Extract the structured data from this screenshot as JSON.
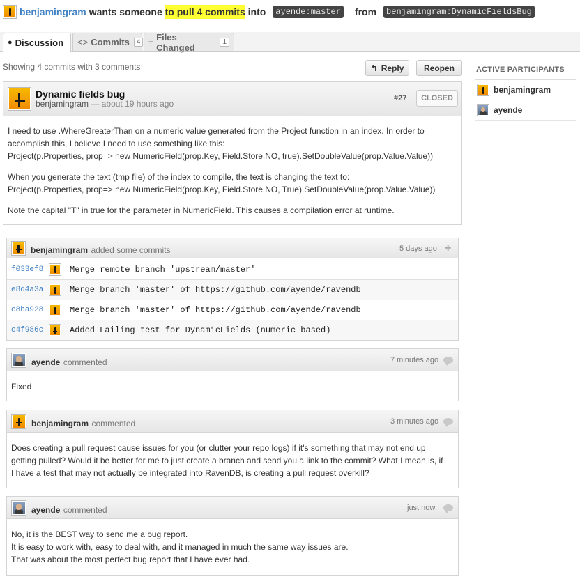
{
  "header": {
    "author": "benjamingram",
    "text_part1": "wants someone ",
    "text_highlight": "to pull 4 commits",
    "text_part2": " into",
    "base_branch": "ayende:master",
    "from": "from",
    "head_branch": "benjamingram:DynamicFieldsBug"
  },
  "tabs": [
    {
      "label": "Discussion",
      "count": ""
    },
    {
      "label": "Commits",
      "count": "4"
    },
    {
      "label": "Files Changed",
      "count": "1"
    }
  ],
  "summary": "Showing 4 commits with 3 comments",
  "buttons": {
    "reply": "Reply",
    "reopen": "Reopen"
  },
  "pull": {
    "title": "Dynamic fields bug",
    "author": "benjamingram",
    "time": "— about 19 hours ago",
    "number": "#27",
    "state": "CLOSED",
    "body": [
      "I need to use .WhereGreaterThan on a numeric value generated from the Project function in an index. In order to",
      "accomplish this, I believe I need to use something like this:",
      "Project(p.Properties, prop=> new NumericField(prop.Key, Field.Store.NO, true).SetDoubleValue(prop.Value.Value))",
      "When you generate the text (tmp file) of the index to compile, the text is changing the text to:",
      "Project(p.Properties, prop=> new NumericField(prop.Key, Field.Store.NO, True).SetDoubleValue(prop.Value.Value))",
      "Note the capital \"T\" in true for the parameter in NumericField. This causes a compilation error at runtime."
    ]
  },
  "commits_block": {
    "author": "benjamingram",
    "action": "added some commits",
    "time": "5 days ago",
    "commits": [
      {
        "sha": "f033ef8",
        "message": "Merge remote branch 'upstream/master'"
      },
      {
        "sha": "e8d4a3a",
        "message": "Merge branch 'master' of https://github.com/ayende/ravendb"
      },
      {
        "sha": "c8ba928",
        "message": "Merge branch 'master' of https://github.com/ayende/ravendb"
      },
      {
        "sha": "c4f986c",
        "message": "Added Failing test for DynamicFields (numeric based)"
      }
    ]
  },
  "comments": [
    {
      "author": "ayende",
      "action": "commented",
      "time": "7 minutes ago",
      "lines": [
        "Fixed"
      ]
    },
    {
      "author": "benjamingram",
      "action": "commented",
      "time": "3 minutes ago",
      "lines": [
        "Does creating a pull request cause issues for you (or clutter your repo logs) if it's something that may not end up",
        "getting pulled? Would it be better for me to just create a branch and send you a link to the commit? What I mean is, if",
        "I have a test that may not actually be integrated into RavenDB, is creating a pull request overkill?"
      ]
    },
    {
      "author": "ayende",
      "action": "commented",
      "time": "just now",
      "lines": [
        "No, it is the BEST way to send me a bug report.",
        "It is easy to work with, easy to deal with, and it managed in much the same way issues are.",
        "That was about the most perfect bug report that I have ever had."
      ]
    }
  ],
  "sidebar": {
    "title": "ACTIVE PARTICIPANTS",
    "participants": [
      "benjamingram",
      "ayende"
    ]
  },
  "colors": {
    "link": "#4183c4",
    "highlight": "#ffff33",
    "branch_bg": "#444444"
  }
}
